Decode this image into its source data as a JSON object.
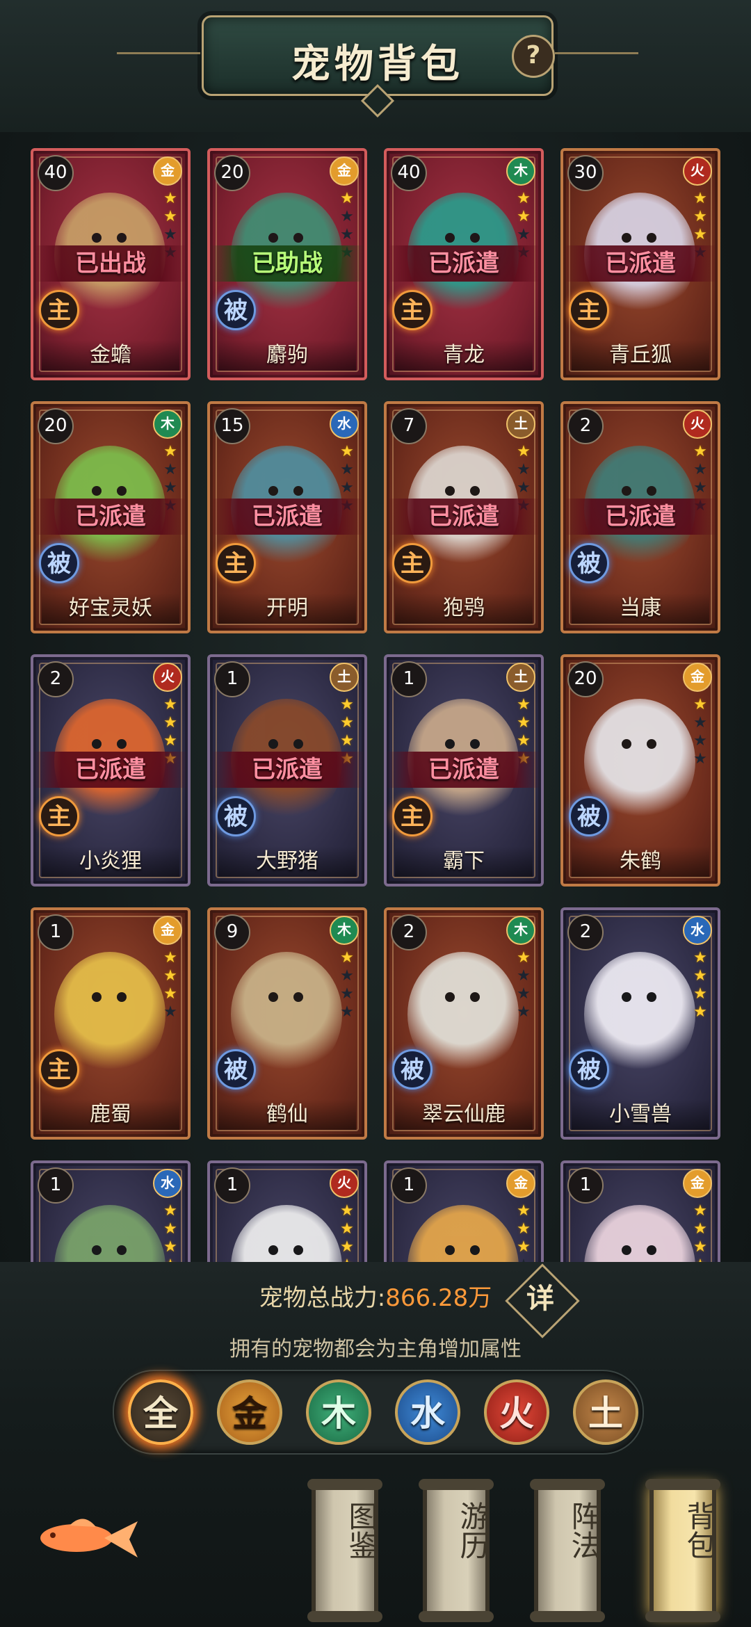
{
  "header": {
    "title": "宠物背包",
    "help_label": "?"
  },
  "pets": [
    {
      "level": "40",
      "element": "金",
      "stars": 2,
      "status": "已出战",
      "status_type": "battle",
      "role": "主",
      "name": "金蟾",
      "frame": "red",
      "color": "#c7a067"
    },
    {
      "level": "20",
      "element": "金",
      "stars": 1,
      "status": "已助战",
      "status_type": "help",
      "role": "被",
      "name": "麝驹",
      "frame": "red",
      "color": "#3f8f74"
    },
    {
      "level": "40",
      "element": "木",
      "stars": 2,
      "status": "已派遣",
      "status_type": "dispatch",
      "role": "主",
      "name": "青龙",
      "frame": "red",
      "color": "#2a9c8c"
    },
    {
      "level": "30",
      "element": "火",
      "stars": 3,
      "status": "已派遣",
      "status_type": "dispatch",
      "role": "主",
      "name": "青丘狐",
      "frame": "orange",
      "color": "#d8d4e6"
    },
    {
      "level": "20",
      "element": "木",
      "stars": 1,
      "status": "已派遣",
      "status_type": "dispatch",
      "role": "被",
      "name": "好宝灵妖",
      "frame": "orange",
      "color": "#7cbf4c"
    },
    {
      "level": "15",
      "element": "水",
      "stars": 1,
      "status": "已派遣",
      "status_type": "dispatch",
      "role": "主",
      "name": "开明",
      "frame": "orange",
      "color": "#4f8fa0"
    },
    {
      "level": "7",
      "element": "土",
      "stars": 1,
      "status": "已派遣",
      "status_type": "dispatch",
      "role": "主",
      "name": "狍鸮",
      "frame": "orange",
      "color": "#ddd8d2"
    },
    {
      "level": "2",
      "element": "火",
      "stars": 1,
      "status": "已派遣",
      "status_type": "dispatch",
      "role": "被",
      "name": "当康",
      "frame": "orange",
      "color": "#3f7d78"
    },
    {
      "level": "2",
      "element": "火",
      "stars": 4,
      "status": "已派遣",
      "status_type": "dispatch",
      "role": "主",
      "name": "小炎狸",
      "frame": "purple",
      "color": "#e0672e"
    },
    {
      "level": "1",
      "element": "土",
      "stars": 4,
      "status": "已派遣",
      "status_type": "dispatch",
      "role": "被",
      "name": "大野猪",
      "frame": "purple",
      "color": "#8a4a2a"
    },
    {
      "level": "1",
      "element": "土",
      "stars": 4,
      "status": "已派遣",
      "status_type": "dispatch",
      "role": "主",
      "name": "霸下",
      "frame": "purple",
      "color": "#c9a98a"
    },
    {
      "level": "20",
      "element": "金",
      "stars": 1,
      "status": "",
      "status_type": "none",
      "role": "被",
      "name": "朱鹤",
      "frame": "orange",
      "color": "#e6e6ea"
    },
    {
      "level": "1",
      "element": "金",
      "stars": 3,
      "status": "",
      "status_type": "none",
      "role": "主",
      "name": "鹿蜀",
      "frame": "orange",
      "color": "#e6c04a"
    },
    {
      "level": "9",
      "element": "木",
      "stars": 1,
      "status": "",
      "status_type": "none",
      "role": "被",
      "name": "鹤仙",
      "frame": "orange",
      "color": "#c9b48a"
    },
    {
      "level": "2",
      "element": "木",
      "stars": 1,
      "status": "",
      "status_type": "none",
      "role": "被",
      "name": "翠云仙鹿",
      "frame": "orange",
      "color": "#e2e2da"
    },
    {
      "level": "2",
      "element": "水",
      "stars": 4,
      "status": "",
      "status_type": "none",
      "role": "被",
      "name": "小雪兽",
      "frame": "purple",
      "color": "#f1eef6"
    },
    {
      "level": "1",
      "element": "水",
      "stars": 4,
      "status": "",
      "status_type": "none",
      "role": "",
      "name": "",
      "frame": "purple",
      "color": "#7aa46a"
    },
    {
      "level": "1",
      "element": "火",
      "stars": 4,
      "status": "",
      "status_type": "none",
      "role": "",
      "name": "",
      "frame": "purple",
      "color": "#f0f0f0"
    },
    {
      "level": "1",
      "element": "金",
      "stars": 3,
      "status": "",
      "status_type": "none",
      "role": "",
      "name": "",
      "frame": "purple",
      "color": "#e8a84a"
    },
    {
      "level": "1",
      "element": "金",
      "stars": 4,
      "status": "",
      "status_type": "none",
      "role": "",
      "name": "",
      "frame": "purple",
      "color": "#eed6e0"
    }
  ],
  "footer": {
    "power_label": "宠物总战力:",
    "power_value": "866.28万",
    "detail_label": "详",
    "subtitle": "拥有的宠物都会为主角增加属性",
    "filters": [
      {
        "label": "全",
        "kind": "all"
      },
      {
        "label": "金",
        "kind": "gold"
      },
      {
        "label": "木",
        "kind": "wood"
      },
      {
        "label": "水",
        "kind": "water"
      },
      {
        "label": "火",
        "kind": "fire"
      },
      {
        "label": "土",
        "kind": "earth"
      }
    ],
    "tabs": [
      {
        "label": "图鉴",
        "active": false
      },
      {
        "label": "游历",
        "active": false
      },
      {
        "label": "阵法",
        "active": false
      },
      {
        "label": "背包",
        "active": true
      }
    ]
  },
  "colors": {
    "element_gold": "#e39c2c",
    "element_wood": "#1f8a52",
    "element_water": "#2a68b8",
    "element_fire": "#b02a1f",
    "element_earth": "#8a5c2c"
  }
}
